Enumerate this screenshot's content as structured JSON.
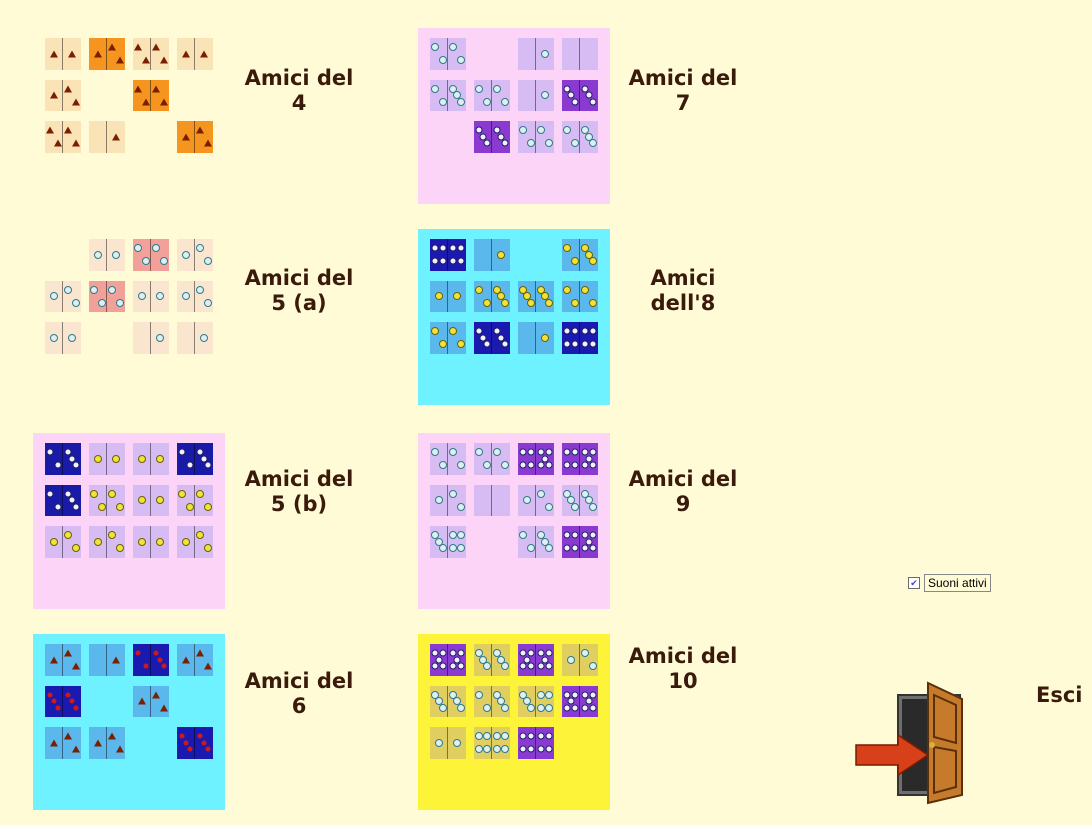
{
  "games": [
    {
      "id": "game-4",
      "label_lines": [
        "Amici del",
        "4"
      ],
      "background": "#fffbd6",
      "tile_light": "#fbe3b8",
      "tile_dark": "#f59520",
      "dot": "tri",
      "grid": [
        [
          "L",
          2
        ],
        [
          "D",
          3
        ],
        [
          "L",
          4
        ],
        [
          "L",
          2
        ],
        [
          "L",
          3
        ],
        null,
        [
          "D",
          4
        ],
        null,
        [
          "L",
          4
        ],
        [
          "L",
          1
        ],
        null,
        [
          "D",
          3
        ]
      ]
    },
    {
      "id": "game-5a",
      "label_lines": [
        "Amici del",
        "5 (a)"
      ],
      "background": "#fffbd6",
      "tile_light": "#fae6cf",
      "tile_dark": "#f2a09a",
      "dot": "circ",
      "grid": [
        null,
        [
          "L",
          2
        ],
        [
          "D",
          4
        ],
        [
          "L",
          3
        ],
        [
          "L",
          3
        ],
        [
          "D",
          4
        ],
        [
          "L",
          2
        ],
        [
          "L",
          3
        ],
        [
          "L",
          2
        ],
        null,
        [
          "L",
          1
        ],
        [
          "L",
          1
        ]
      ]
    },
    {
      "id": "game-5b",
      "label_lines": [
        "Amici del",
        "5 (b)"
      ],
      "background": "#fbd4f7",
      "tile_light": "#d6bcf2",
      "tile_dark": "#1a1aa8",
      "dot": "ydot",
      "grid": [
        [
          "D",
          5
        ],
        [
          "L",
          2
        ],
        [
          "L",
          2
        ],
        [
          "D",
          5
        ],
        [
          "D",
          5
        ],
        [
          "L",
          4
        ],
        [
          "L",
          2
        ],
        [
          "L",
          4
        ],
        [
          "L",
          3
        ],
        [
          "L",
          3
        ],
        [
          "L",
          2
        ],
        [
          "L",
          3
        ]
      ]
    },
    {
      "id": "game-6",
      "label_lines": [
        "Amici del",
        "6"
      ],
      "background": "#6ef2ff",
      "tile_light": "#5ab8ec",
      "tile_dark": "#1a1ab0",
      "dot": "tri",
      "grid": [
        [
          "L",
          3
        ],
        [
          "L",
          1
        ],
        [
          "D",
          5
        ],
        [
          "L",
          3
        ],
        [
          "D",
          6
        ],
        null,
        [
          "L",
          3
        ],
        null,
        [
          "L",
          3
        ],
        [
          "L",
          3
        ],
        null,
        [
          "D",
          6
        ]
      ]
    },
    {
      "id": "game-7",
      "label_lines": [
        "Amici del",
        "7"
      ],
      "background": "#fbd4f7",
      "tile_light": "#d6bcf2",
      "tile_dark": "#8a3ad0",
      "dot": "circ",
      "grid": [
        [
          "L",
          4
        ],
        null,
        [
          "L",
          1
        ],
        [
          "L",
          0
        ],
        [
          "L",
          5
        ],
        [
          "L",
          4
        ],
        [
          "L",
          1
        ],
        [
          "D",
          6
        ],
        null,
        [
          "D",
          6
        ],
        [
          "L",
          4
        ],
        [
          "L",
          5
        ]
      ]
    },
    {
      "id": "game-8",
      "label_lines": [
        "Amici",
        "dell'8"
      ],
      "background": "#6ef2ff",
      "tile_light": "#5ab8ec",
      "tile_dark": "#1a1ab0",
      "dot": "ydot",
      "grid": [
        [
          "D",
          8
        ],
        [
          "L",
          1
        ],
        null,
        [
          "L",
          5
        ],
        [
          "L",
          2
        ],
        [
          "L",
          5
        ],
        [
          "L",
          6
        ],
        [
          "L",
          4
        ],
        [
          "L",
          4
        ],
        [
          "D",
          6
        ],
        [
          "L",
          1
        ],
        [
          "D",
          8
        ]
      ]
    },
    {
      "id": "game-9",
      "label_lines": [
        "Amici del",
        "9"
      ],
      "background": "#fbd4f7",
      "tile_light": "#d6bcf2",
      "tile_dark": "#8a3ad0",
      "dot": "circ",
      "grid": [
        [
          "L",
          4
        ],
        [
          "L",
          4
        ],
        [
          "D",
          9
        ],
        [
          "D",
          9
        ],
        [
          "L",
          3
        ],
        [
          "L",
          0
        ],
        [
          "L",
          3
        ],
        [
          "L",
          6
        ],
        [
          "L",
          7
        ],
        null,
        [
          "L",
          5
        ],
        [
          "D",
          9
        ]
      ]
    },
    {
      "id": "game-10",
      "label_lines": [
        "Amici del",
        "10"
      ],
      "background": "#fdf43a",
      "tile_light": "#e0cf60",
      "tile_dark": "#8a3ad0",
      "dot": "circ",
      "grid": [
        [
          "D",
          10
        ],
        [
          "L",
          6
        ],
        [
          "D",
          10
        ],
        [
          "L",
          3
        ],
        [
          "L",
          6
        ],
        [
          "L",
          5
        ],
        [
          "L",
          7
        ],
        [
          "D",
          10
        ],
        [
          "L",
          2
        ],
        [
          "L",
          8
        ],
        [
          "D",
          8
        ],
        null
      ]
    }
  ],
  "sound_toggle": {
    "label": "Suoni attivi",
    "checked": true,
    "check_glyph": "✔"
  },
  "exit": {
    "label": "Esci",
    "icon": "exit-door-icon"
  }
}
